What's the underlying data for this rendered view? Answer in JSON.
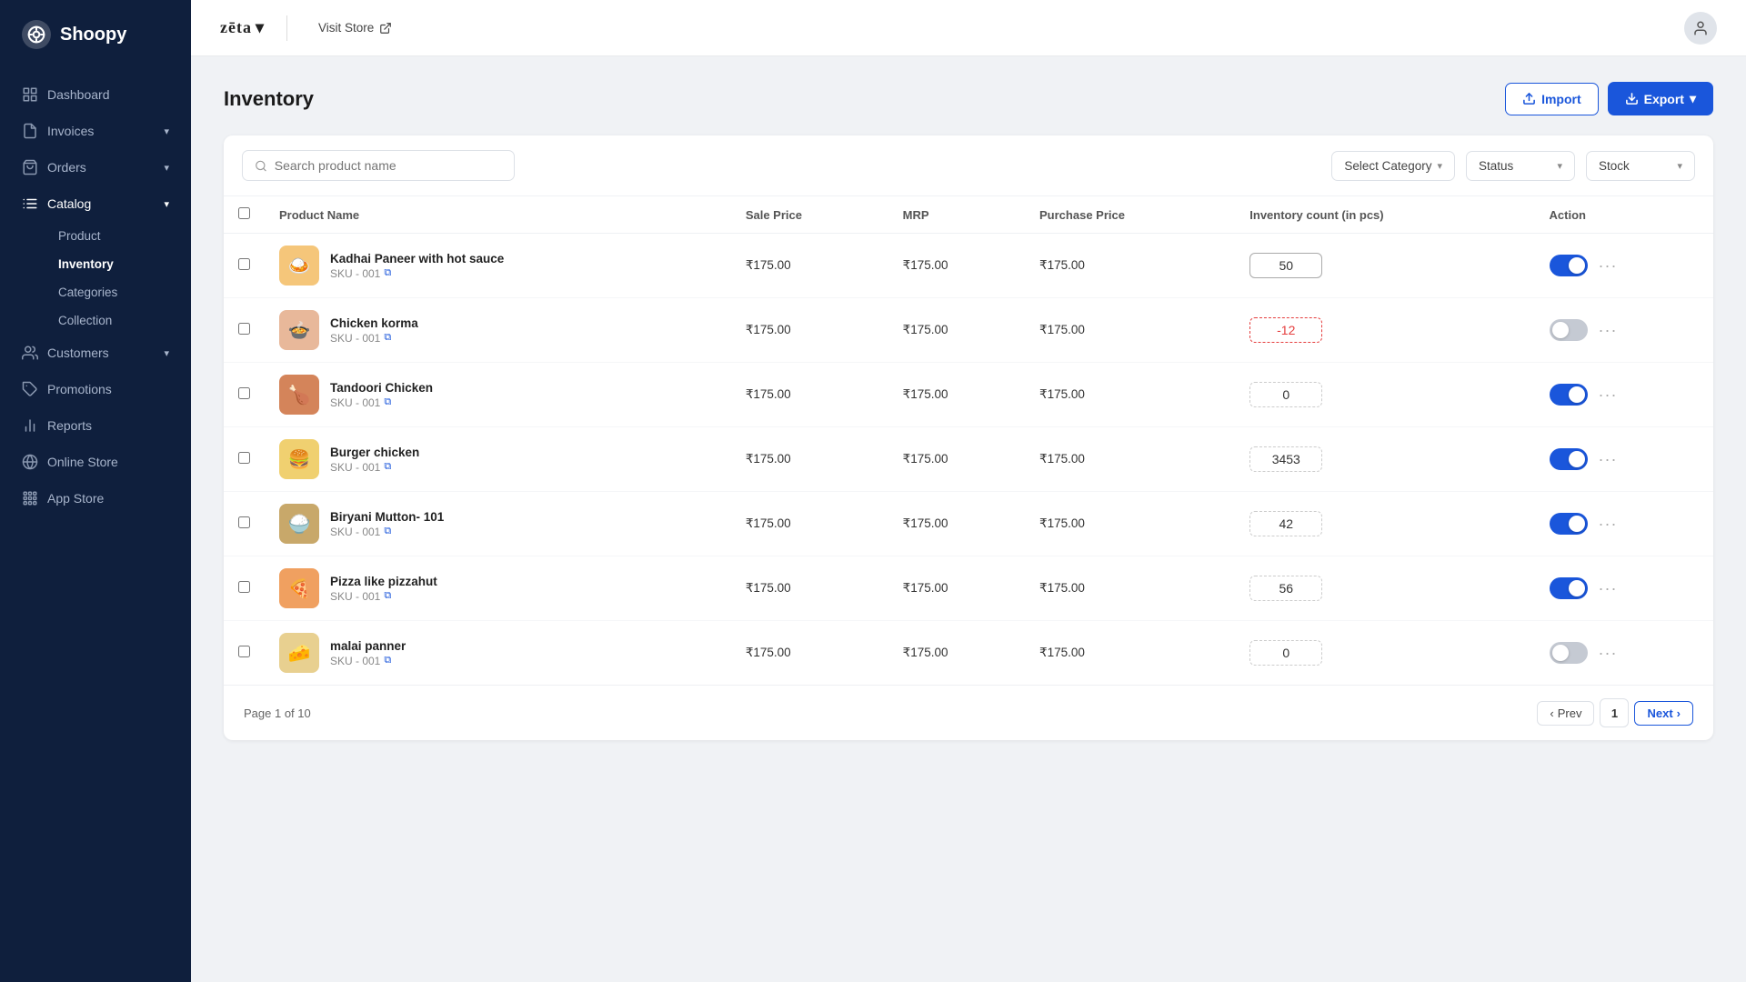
{
  "sidebar": {
    "brand": "Shoopy",
    "nav": [
      {
        "id": "dashboard",
        "label": "Dashboard",
        "icon": "grid",
        "active": false,
        "expandable": false
      },
      {
        "id": "invoices",
        "label": "Invoices",
        "icon": "file-text",
        "active": false,
        "expandable": true
      },
      {
        "id": "orders",
        "label": "Orders",
        "icon": "shopping-bag",
        "active": false,
        "expandable": true
      },
      {
        "id": "catalog",
        "label": "Catalog",
        "icon": "list",
        "active": true,
        "expandable": true,
        "children": [
          {
            "id": "product",
            "label": "Product",
            "active": false
          },
          {
            "id": "inventory",
            "label": "Inventory",
            "active": true
          },
          {
            "id": "categories",
            "label": "Categories",
            "active": false
          },
          {
            "id": "collection",
            "label": "Collection",
            "active": false
          }
        ]
      },
      {
        "id": "customers",
        "label": "Customers",
        "icon": "users",
        "active": false,
        "expandable": true
      },
      {
        "id": "promotions",
        "label": "Promotions",
        "icon": "tag",
        "active": false,
        "expandable": false
      },
      {
        "id": "reports",
        "label": "Reports",
        "icon": "bar-chart",
        "active": false,
        "expandable": false
      },
      {
        "id": "online-store",
        "label": "Online Store",
        "icon": "globe",
        "active": false,
        "expandable": false
      },
      {
        "id": "app-store",
        "label": "App Store",
        "icon": "grid-2",
        "active": false,
        "expandable": false
      }
    ]
  },
  "topbar": {
    "brand": "zēta",
    "visit_store_label": "Visit Store",
    "chevron_label": "▾"
  },
  "page": {
    "title": "Inventory",
    "import_label": "Import",
    "export_label": "Export"
  },
  "filters": {
    "search_placeholder": "Search product name",
    "category_label": "Select Category",
    "status_label": "Status",
    "stock_label": "Stock"
  },
  "table": {
    "columns": [
      "Product Name",
      "Sale Price",
      "MRP",
      "Purchase Price",
      "Inventory count (in pcs)",
      "Action"
    ],
    "rows": [
      {
        "id": 1,
        "name": "Kadhai Paneer with hot sauce",
        "sku": "SKU - 001",
        "sale_price": "₹175.00",
        "mrp": "₹175.00",
        "purchase_price": "₹175.00",
        "inventory": "50",
        "enabled": true,
        "img_emoji": "🍛",
        "img_color": "#f5c67a",
        "negative": false,
        "solid": true
      },
      {
        "id": 2,
        "name": "Chicken korma",
        "sku": "SKU - 001",
        "sale_price": "₹175.00",
        "mrp": "₹175.00",
        "purchase_price": "₹175.00",
        "inventory": "-12",
        "enabled": false,
        "img_emoji": "🍲",
        "img_color": "#e8b89a",
        "negative": true,
        "solid": false
      },
      {
        "id": 3,
        "name": "Tandoori Chicken",
        "sku": "SKU - 001",
        "sale_price": "₹175.00",
        "mrp": "₹175.00",
        "purchase_price": "₹175.00",
        "inventory": "0",
        "enabled": true,
        "img_emoji": "🍗",
        "img_color": "#d4845a",
        "negative": false,
        "solid": false
      },
      {
        "id": 4,
        "name": "Burger chicken",
        "sku": "SKU - 001",
        "sale_price": "₹175.00",
        "mrp": "₹175.00",
        "purchase_price": "₹175.00",
        "inventory": "3453",
        "enabled": true,
        "img_emoji": "🍔",
        "img_color": "#f0d070",
        "negative": false,
        "solid": false
      },
      {
        "id": 5,
        "name": "Biryani Mutton- 101",
        "sku": "SKU - 001",
        "sale_price": "₹175.00",
        "mrp": "₹175.00",
        "purchase_price": "₹175.00",
        "inventory": "42",
        "enabled": true,
        "img_emoji": "🍚",
        "img_color": "#c8a86a",
        "negative": false,
        "solid": false
      },
      {
        "id": 6,
        "name": "Pizza like pizzahut",
        "sku": "SKU - 001",
        "sale_price": "₹175.00",
        "mrp": "₹175.00",
        "purchase_price": "₹175.00",
        "inventory": "56",
        "enabled": true,
        "img_emoji": "🍕",
        "img_color": "#f0a060",
        "negative": false,
        "solid": false
      },
      {
        "id": 7,
        "name": "malai panner",
        "sku": "SKU - 001",
        "sale_price": "₹175.00",
        "mrp": "₹175.00",
        "purchase_price": "₹175.00",
        "inventory": "0",
        "enabled": false,
        "img_emoji": "🧀",
        "img_color": "#e8d090",
        "negative": false,
        "solid": false
      }
    ]
  },
  "pagination": {
    "page_label": "Page 1 of 10",
    "prev_label": "Prev",
    "next_label": "Next",
    "current_page": "1"
  }
}
